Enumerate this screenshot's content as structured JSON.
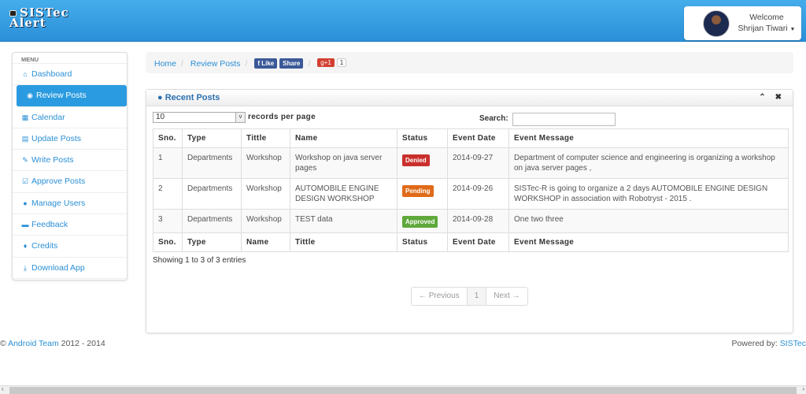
{
  "header": {
    "logo": [
      "SISTec",
      "Alert"
    ],
    "welcome": "Welcome",
    "user": "Shrijan Tiwari"
  },
  "sidebar": {
    "menu_label": "MENU",
    "items": [
      {
        "label": "Dashboard",
        "icon": "home-icon",
        "glyph": "⌂"
      },
      {
        "label": "Review Posts",
        "icon": "eye-icon",
        "glyph": "◉"
      },
      {
        "label": "Calendar",
        "icon": "calendar-icon",
        "glyph": "▦"
      },
      {
        "label": "Update Posts",
        "icon": "list-icon",
        "glyph": "▤"
      },
      {
        "label": "Write Posts",
        "icon": "edit-icon",
        "glyph": "✎"
      },
      {
        "label": "Approve Posts",
        "icon": "check-icon",
        "glyph": "☑"
      },
      {
        "label": "Manage Users",
        "icon": "user-icon",
        "glyph": "●"
      },
      {
        "label": "Feedback",
        "icon": "comment-icon",
        "glyph": "▬"
      },
      {
        "label": "Credits",
        "icon": "thumbs-up-icon",
        "glyph": "♦"
      },
      {
        "label": "Download App",
        "icon": "download-icon",
        "glyph": "⤓"
      }
    ]
  },
  "breadcrumb": {
    "home": "Home",
    "current": "Review Posts",
    "fb_like": "Like",
    "fb_share": "Share",
    "gplus": "g+1",
    "gplus_count": "1"
  },
  "panel": {
    "title": "Recent Posts",
    "page_size": "10",
    "records_label": "records per page",
    "search_label": "Search:",
    "search_value": "",
    "columns": [
      "Sno.",
      "Type",
      "Tittle",
      "Name",
      "Status",
      "Event Date",
      "Event Message"
    ],
    "footer_columns": [
      "Sno.",
      "Type",
      "Name",
      "Tittle",
      "Status",
      "Event Date",
      "Event Message"
    ],
    "rows": [
      {
        "sno": "1",
        "type": "Departments",
        "title": "Workshop",
        "name": "Workshop on java server pages",
        "status": "Denied",
        "status_color": "#c9302c",
        "date": "2014-09-27",
        "message": "Department of computer science and engineering is organizing a workshop on java server pages ,"
      },
      {
        "sno": "2",
        "type": "Departments",
        "title": "Workshop",
        "name": "AUTOMOBILE ENGINE DESIGN WORKSHOP",
        "status": "Pending",
        "status_color": "#e06a18",
        "date": "2014-09-26",
        "message": "SISTec-R is going to organize a 2 days AUTOMOBILE ENGINE DESIGN WORKSHOP in association with Robotryst - 2015 ."
      },
      {
        "sno": "3",
        "type": "Departments",
        "title": "Workshop",
        "name": "TEST data",
        "status": "Approved",
        "status_color": "#5fa83a",
        "date": "2014-09-28",
        "message": "One two three"
      }
    ],
    "info": "Showing 1 to 3 of 3 entries",
    "pager": {
      "prev": "← Previous",
      "page": "1",
      "next": "Next →"
    }
  },
  "footer": {
    "copy": "©",
    "team": "Android Team",
    "years": " 2012 - 2014",
    "powered": "Powered by: ",
    "brand": "SISTec"
  }
}
